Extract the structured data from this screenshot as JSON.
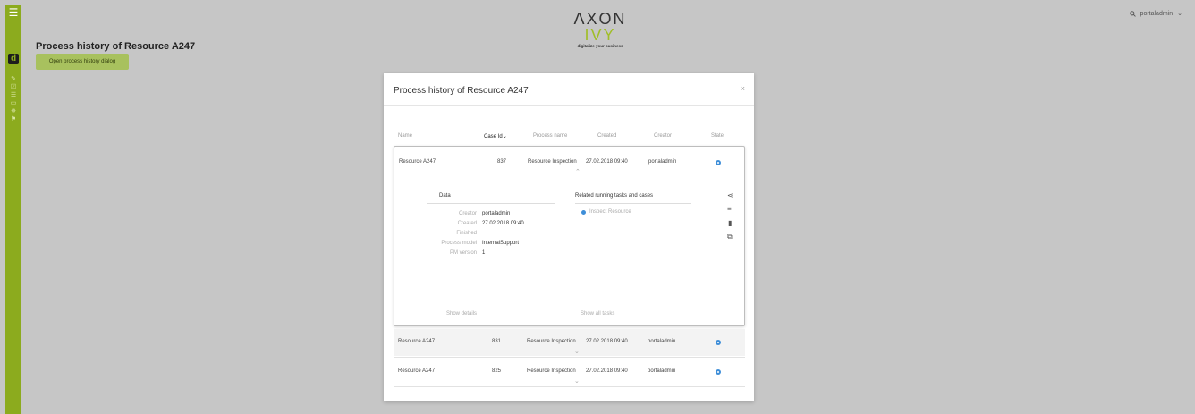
{
  "brand": {
    "word_left": "ΛXON ",
    "word_right": "IVY",
    "tagline": "digitalize your business"
  },
  "user": {
    "search_icon": "search-icon",
    "name": "portaladmin",
    "caret": "⌄"
  },
  "page": {
    "title": "Process history of Resource A247",
    "open_button": "Open process history dialog"
  },
  "rail": {
    "menu": "☰",
    "logo": "d",
    "icons": [
      "✎",
      "☑",
      "☰",
      "▭",
      "⛯",
      "⚑"
    ]
  },
  "modal": {
    "title": "Process history of Resource A247",
    "close": "×",
    "columns": {
      "name": "Name",
      "case_id": "Case Id",
      "sort_arrow": "⌄",
      "process_name": "Process name",
      "created": "Created",
      "creator": "Creator",
      "state": "State"
    },
    "rows": [
      {
        "name": "Resource A247",
        "case_id": "837",
        "process": "Resource Inspection",
        "created": "27.02.2018 09:40",
        "creator": "portaladmin",
        "chevron": "⌃"
      },
      {
        "name": "Resource A247",
        "case_id": "831",
        "process": "Resource Inspection",
        "created": "27.02.2018 09:40",
        "creator": "portaladmin",
        "chevron": "⌄"
      },
      {
        "name": "Resource A247",
        "case_id": "825",
        "process": "Resource Inspection",
        "created": "27.02.2018 09:40",
        "creator": "portaladmin",
        "chevron": "⌄"
      }
    ],
    "details": {
      "data_title": "Data",
      "related_title": "Related running tasks and cases",
      "fields": [
        {
          "label": "Creator",
          "value": "portaladmin"
        },
        {
          "label": "Created",
          "value": "27.02.2018 09:40"
        },
        {
          "label": "Finished",
          "value": ""
        },
        {
          "label": "Process model",
          "value": "InternalSupport"
        },
        {
          "label": "PM version",
          "value": "1"
        }
      ],
      "task": "Inspect Resource",
      "show_details": "Show details",
      "show_all_tasks": "Show all tasks",
      "side_icons": {
        "share": "⋖",
        "list": "≡",
        "doc": "▮",
        "copy": "⧉"
      }
    }
  },
  "colors": {
    "accent": "#8cab1e",
    "state": "#3e8ed8",
    "overlay": "#c6c6c6"
  }
}
